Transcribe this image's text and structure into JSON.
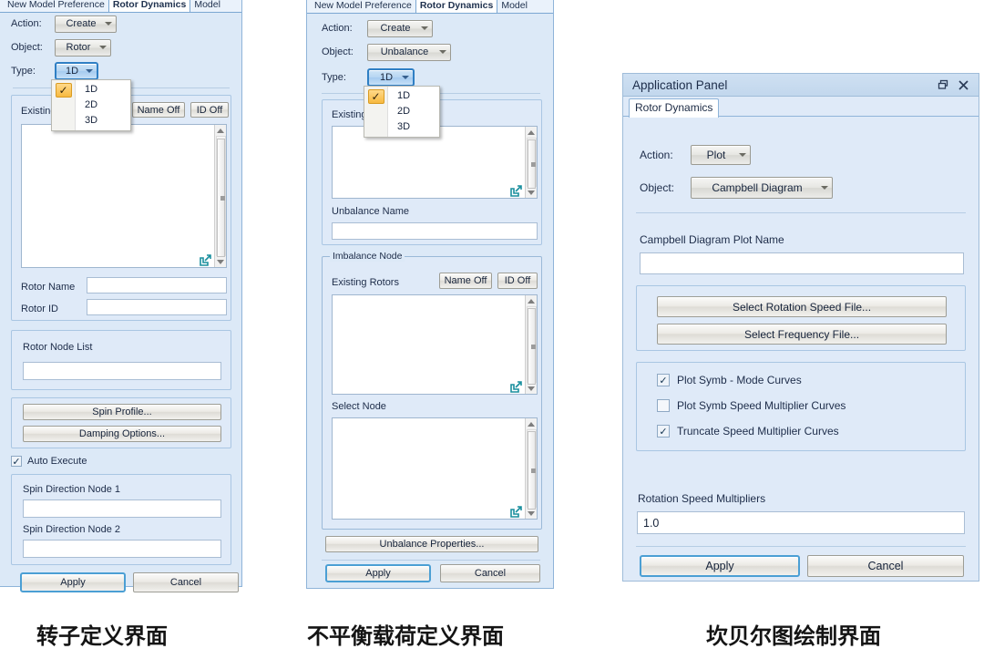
{
  "panel1": {
    "caption": "转子定义界面",
    "tabs": [
      {
        "label": "New Model Preference",
        "active": false
      },
      {
        "label": "Rotor Dynamics",
        "active": true
      },
      {
        "label": "Model",
        "active": false
      }
    ],
    "action_label": "Action:",
    "action_value": "Create",
    "object_label": "Object:",
    "object_value": "Rotor",
    "type_label": "Type:",
    "type_value": "1D",
    "type_options": [
      "1D",
      "2D",
      "3D"
    ],
    "type_selected": "1D",
    "existing_label": "Existing Rotors",
    "name_off_button": "Name Off",
    "id_off_button": "ID Off",
    "rotor_name_label": "Rotor Name",
    "rotor_name_value": "",
    "rotor_id_label": "Rotor ID",
    "rotor_id_value": "",
    "rotor_node_list_label": "Rotor Node List",
    "rotor_node_list_value": "",
    "spin_profile_button": "Spin Profile...",
    "damping_options_button": "Damping Options...",
    "auto_execute_label": "Auto Execute",
    "auto_execute_checked": true,
    "spin_dir_1_label": "Spin Direction Node 1",
    "spin_dir_1_value": "",
    "spin_dir_2_label": "Spin Direction Node 2",
    "spin_dir_2_value": "",
    "apply_button": "Apply",
    "cancel_button": "Cancel"
  },
  "panel2": {
    "caption": "不平衡载荷定义界面",
    "tabs": [
      {
        "label": "New Model Preference",
        "active": false
      },
      {
        "label": "Rotor Dynamics",
        "active": true
      },
      {
        "label": "Model",
        "active": false
      }
    ],
    "action_label": "Action:",
    "action_value": "Create",
    "object_label": "Object:",
    "object_value": "Unbalance",
    "type_label": "Type:",
    "type_value": "1D",
    "type_options": [
      "1D",
      "2D",
      "3D"
    ],
    "type_selected": "1D",
    "existing_label": "Existing",
    "unbalance_name_label": "Unbalance Name",
    "unbalance_name_value": "",
    "imbalance_group_title": "Imbalance Node",
    "existing_rotors_label": "Existing Rotors",
    "name_off_button": "Name Off",
    "id_off_button": "ID Off",
    "select_node_label": "Select Node",
    "unbalance_properties_button": "Unbalance Properties...",
    "apply_button": "Apply",
    "cancel_button": "Cancel"
  },
  "panel3": {
    "caption": "坎贝尔图绘制界面",
    "window_title": "Application Panel",
    "restore_icon": "restore-icon",
    "close_icon": "close-icon",
    "tabs": [
      {
        "label": "Rotor Dynamics",
        "active": true
      }
    ],
    "action_label": "Action:",
    "action_value": "Plot",
    "object_label": "Object:",
    "object_value": "Campbell Diagram",
    "plot_name_label": "Campbell Diagram Plot Name",
    "plot_name_value": "",
    "select_rotation_speed_file_button": "Select Rotation Speed File...",
    "select_frequency_file_button": "Select Frequency File...",
    "checkboxes": [
      {
        "label": "Plot Symb - Mode Curves",
        "checked": true
      },
      {
        "label": "Plot Symb Speed Multiplier Curves",
        "checked": false
      },
      {
        "label": "Truncate Speed Multiplier Curves",
        "checked": true
      }
    ],
    "rotation_speed_multipliers_label": "Rotation Speed Multipliers",
    "rotation_speed_multipliers_value": "1.0",
    "apply_button": "Apply",
    "cancel_button": "Cancel"
  },
  "colors": {
    "panel_bg": "#dce9f7",
    "accent_blue": "#2f7fc4",
    "teal_icon": "#1a8f9e",
    "highlight_yellow": "#f7b93f"
  }
}
